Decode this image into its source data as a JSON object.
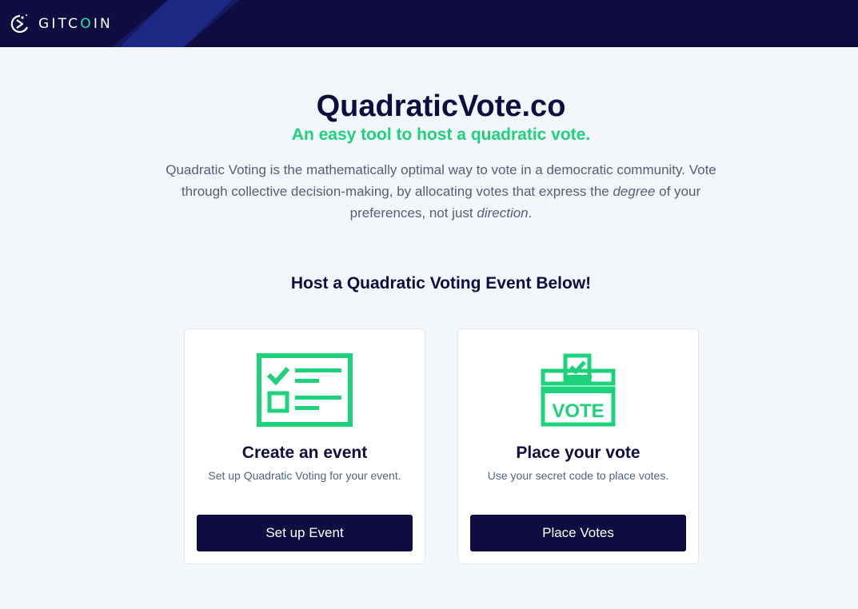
{
  "navbar": {
    "logo_prefix": "GITC",
    "logo_accent": "O",
    "logo_suffix": "IN",
    "logo_icon": "gitcoin-logo-icon",
    "background": "#0f0c42",
    "accent": "#25e899"
  },
  "hero": {
    "title": "QuadraticVote.co",
    "subtitle": "An easy tool to host a quadratic vote.",
    "desc_part1": "Quadratic Voting is the mathematically optimal way to vote in a democratic community. Vote through collective decision-making, by allocating votes that express the ",
    "desc_em1": "degree",
    "desc_part2": " of your preferences, not just ",
    "desc_em2": "direction",
    "desc_part3": "."
  },
  "section_title": "Host a Quadratic Voting Event Below!",
  "cards": [
    {
      "icon": "checklist-icon",
      "title": "Create an event",
      "description": "Set up Quadratic Voting for your event.",
      "button_label": "Set up Event"
    },
    {
      "icon": "ballot-box-icon",
      "title": "Place your vote",
      "description": "Use your secret code to place votes.",
      "button_label": "Place Votes",
      "ballot_text": "VOTE"
    }
  ],
  "colors": {
    "brand_navy": "#0f0c42",
    "brand_green": "#1cd27a",
    "page_bg": "#f3f6fa"
  }
}
